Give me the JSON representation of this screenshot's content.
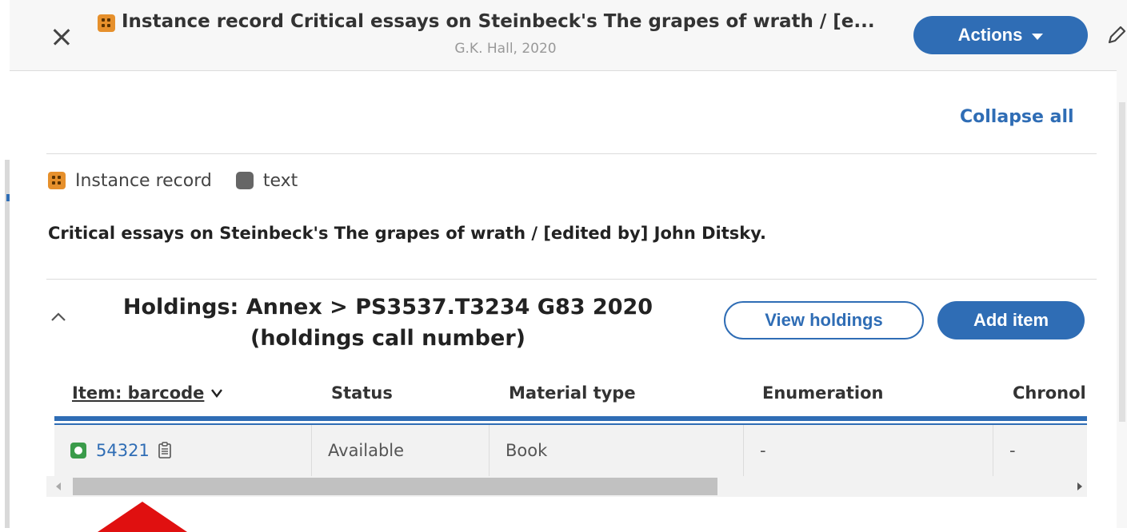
{
  "header": {
    "title": "Instance record Critical essays on Steinbeck's The grapes of wrath / [e...",
    "subtitle": "G.K. Hall, 2020",
    "actions_label": "Actions",
    "icons": {
      "close": "close-icon",
      "record_type": "instance-record-icon",
      "edit": "pencil-icon"
    }
  },
  "controls": {
    "collapse_all": "Collapse all"
  },
  "record": {
    "type_label": "Instance record",
    "resource_type": "text",
    "full_title": "Critical essays on Steinbeck's The grapes of wrath / [edited by] John Ditsky."
  },
  "holdings": {
    "title_line1": "Holdings: Annex > PS3537.T3234 G83 2020",
    "title_line2": "(holdings call number)",
    "view_holdings_label": "View holdings",
    "add_item_label": "Add item",
    "table": {
      "columns": [
        "Item: barcode",
        "Status",
        "Material type",
        "Enumeration",
        "Chronol"
      ],
      "rows": [
        {
          "barcode": "54321",
          "status": "Available",
          "material_type": "Book",
          "enumeration": "-",
          "chronology": "-"
        }
      ]
    }
  },
  "colors": {
    "accent": "#2f6db5",
    "instance_icon": "#e6902c",
    "available": "#3a9b4a",
    "annotation_arrow": "#e01010"
  }
}
